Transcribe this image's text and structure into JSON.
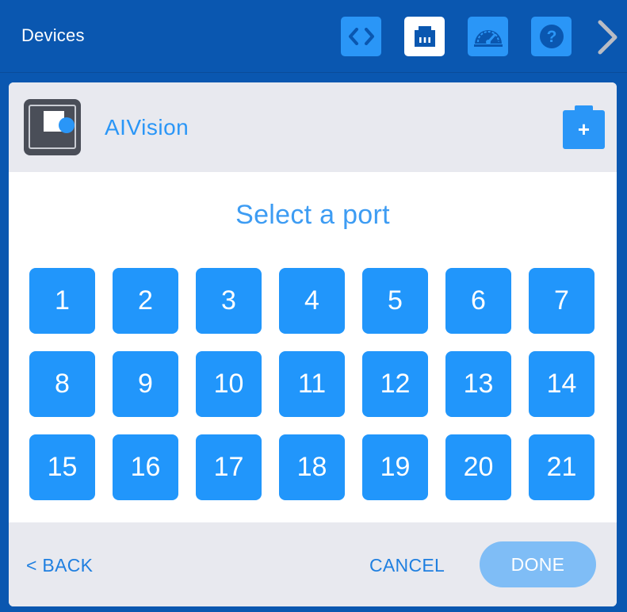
{
  "header": {
    "title": "Devices",
    "tools": [
      {
        "icon": "code-icon",
        "active": false
      },
      {
        "icon": "port-icon",
        "active": true
      },
      {
        "icon": "dashboard-gauge-icon",
        "active": false
      },
      {
        "icon": "help-icon",
        "active": false
      }
    ],
    "next_icon": "chevron-right-icon"
  },
  "device": {
    "name": "AIVision",
    "icon": "ai-vision-sensor-icon",
    "add_label": "+"
  },
  "port_select": {
    "title": "Select a port",
    "ports": [
      "1",
      "2",
      "3",
      "4",
      "5",
      "6",
      "7",
      "8",
      "9",
      "10",
      "11",
      "12",
      "13",
      "14",
      "15",
      "16",
      "17",
      "18",
      "19",
      "20",
      "21"
    ]
  },
  "footer": {
    "back_label": "< BACK",
    "cancel_label": "CANCEL",
    "done_label": "DONE"
  },
  "colors": {
    "topbar_bg": "#0a57b0",
    "accent": "#2196fb",
    "panel_header_bg": "#e8e9ef",
    "done_disabled": "#7fbdf6"
  }
}
